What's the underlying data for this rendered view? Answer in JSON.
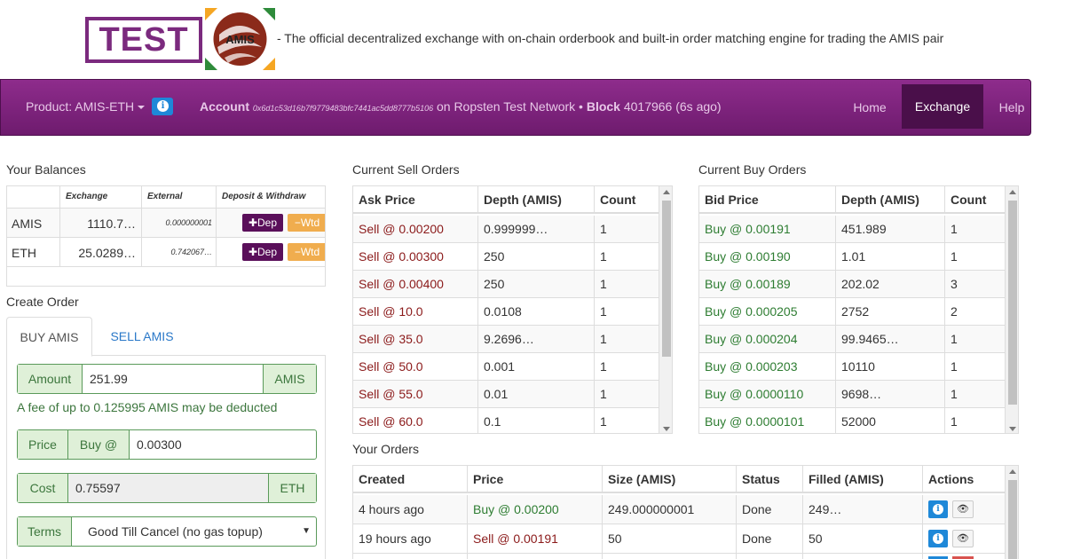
{
  "header": {
    "logo_text": "TEST",
    "logo_badge_text": "AMIS",
    "tagline": "- The official decentralized exchange with on-chain orderbook and built-in order matching engine for trading the AMIS pair"
  },
  "navbar": {
    "product": "Product: AMIS-ETH",
    "account_label": "Account",
    "account_address": "0x6d1c53d16b7f9779483bfc7441ac5dd8777b5106",
    "network": "on Ropsten Test Network •",
    "block_label": "Block",
    "block_value": "4017966 (6s ago)",
    "links": [
      "Home",
      "Exchange",
      "Help"
    ],
    "active_link": "Exchange"
  },
  "balances": {
    "title": "Your Balances",
    "headers": [
      "",
      "Exchange",
      "External",
      "Deposit & Withdraw"
    ],
    "rows": [
      {
        "currency": "AMIS",
        "exchange": "1110.7…",
        "external": "0.000000001"
      },
      {
        "currency": "ETH",
        "exchange": "25.0289…",
        "external": "0.742067…"
      }
    ],
    "deposit_label": "Dep",
    "withdraw_label": "Wtd"
  },
  "create_order": {
    "title": "Create Order",
    "tabs": [
      "BUY AMIS",
      "SELL AMIS"
    ],
    "amount_label": "Amount",
    "amount_value": "251.99",
    "amount_unit": "AMIS",
    "fee_note": "A fee of up to 0.125995 AMIS may be deducted",
    "price_label": "Price",
    "price_side": "Buy @",
    "price_value": "0.00300",
    "cost_label": "Cost",
    "cost_value": "0.75597",
    "cost_unit": "ETH",
    "terms_label": "Terms",
    "terms_value": "Good Till Cancel (no gas topup)"
  },
  "sell_orders": {
    "title": "Current Sell Orders",
    "headers": [
      "Ask Price",
      "Depth (AMIS)",
      "Count"
    ],
    "rows": [
      [
        "Sell @ 0.00200",
        "0.999999…",
        "1"
      ],
      [
        "Sell @ 0.00300",
        "250",
        "1"
      ],
      [
        "Sell @ 0.00400",
        "250",
        "1"
      ],
      [
        "Sell @ 10.0",
        "0.0108",
        "1"
      ],
      [
        "Sell @ 35.0",
        "9.2696…",
        "1"
      ],
      [
        "Sell @ 50.0",
        "0.001",
        "1"
      ],
      [
        "Sell @ 55.0",
        "0.01",
        "1"
      ],
      [
        "Sell @ 60.0",
        "0.1",
        "1"
      ]
    ]
  },
  "buy_orders": {
    "title": "Current Buy Orders",
    "headers": [
      "Bid Price",
      "Depth (AMIS)",
      "Count"
    ],
    "rows": [
      [
        "Buy @ 0.00191",
        "451.989",
        "1"
      ],
      [
        "Buy @ 0.00190",
        "1.01",
        "1"
      ],
      [
        "Buy @ 0.00189",
        "202.02",
        "3"
      ],
      [
        "Buy @ 0.000205",
        "2752",
        "2"
      ],
      [
        "Buy @ 0.000204",
        "99.9465…",
        "1"
      ],
      [
        "Buy @ 0.000203",
        "10110",
        "1"
      ],
      [
        "Buy @ 0.0000110",
        "9698…",
        "1"
      ],
      [
        "Buy @ 0.0000101",
        "52000",
        "1"
      ]
    ]
  },
  "your_orders": {
    "title": "Your Orders",
    "headers": [
      "Created",
      "Price",
      "Size (AMIS)",
      "Status",
      "Filled (AMIS)",
      "Actions"
    ],
    "rows": [
      {
        "created": "4 hours ago",
        "price": "Buy @ 0.00200",
        "side": "buy",
        "size": "249.000000001",
        "status": "Done",
        "filled": "249…"
      },
      {
        "created": "19 hours ago",
        "price": "Sell @ 0.00191",
        "side": "sell",
        "size": "50",
        "status": "Done",
        "filled": "50"
      }
    ]
  },
  "colors": {
    "brand_purple": "#7b2a7e",
    "nav_active": "#4a0f4a",
    "sell_red": "#8b1a1a",
    "buy_green": "#2e7d32",
    "info_blue": "#1e88d8",
    "warning_orange": "#f0ad4e"
  }
}
